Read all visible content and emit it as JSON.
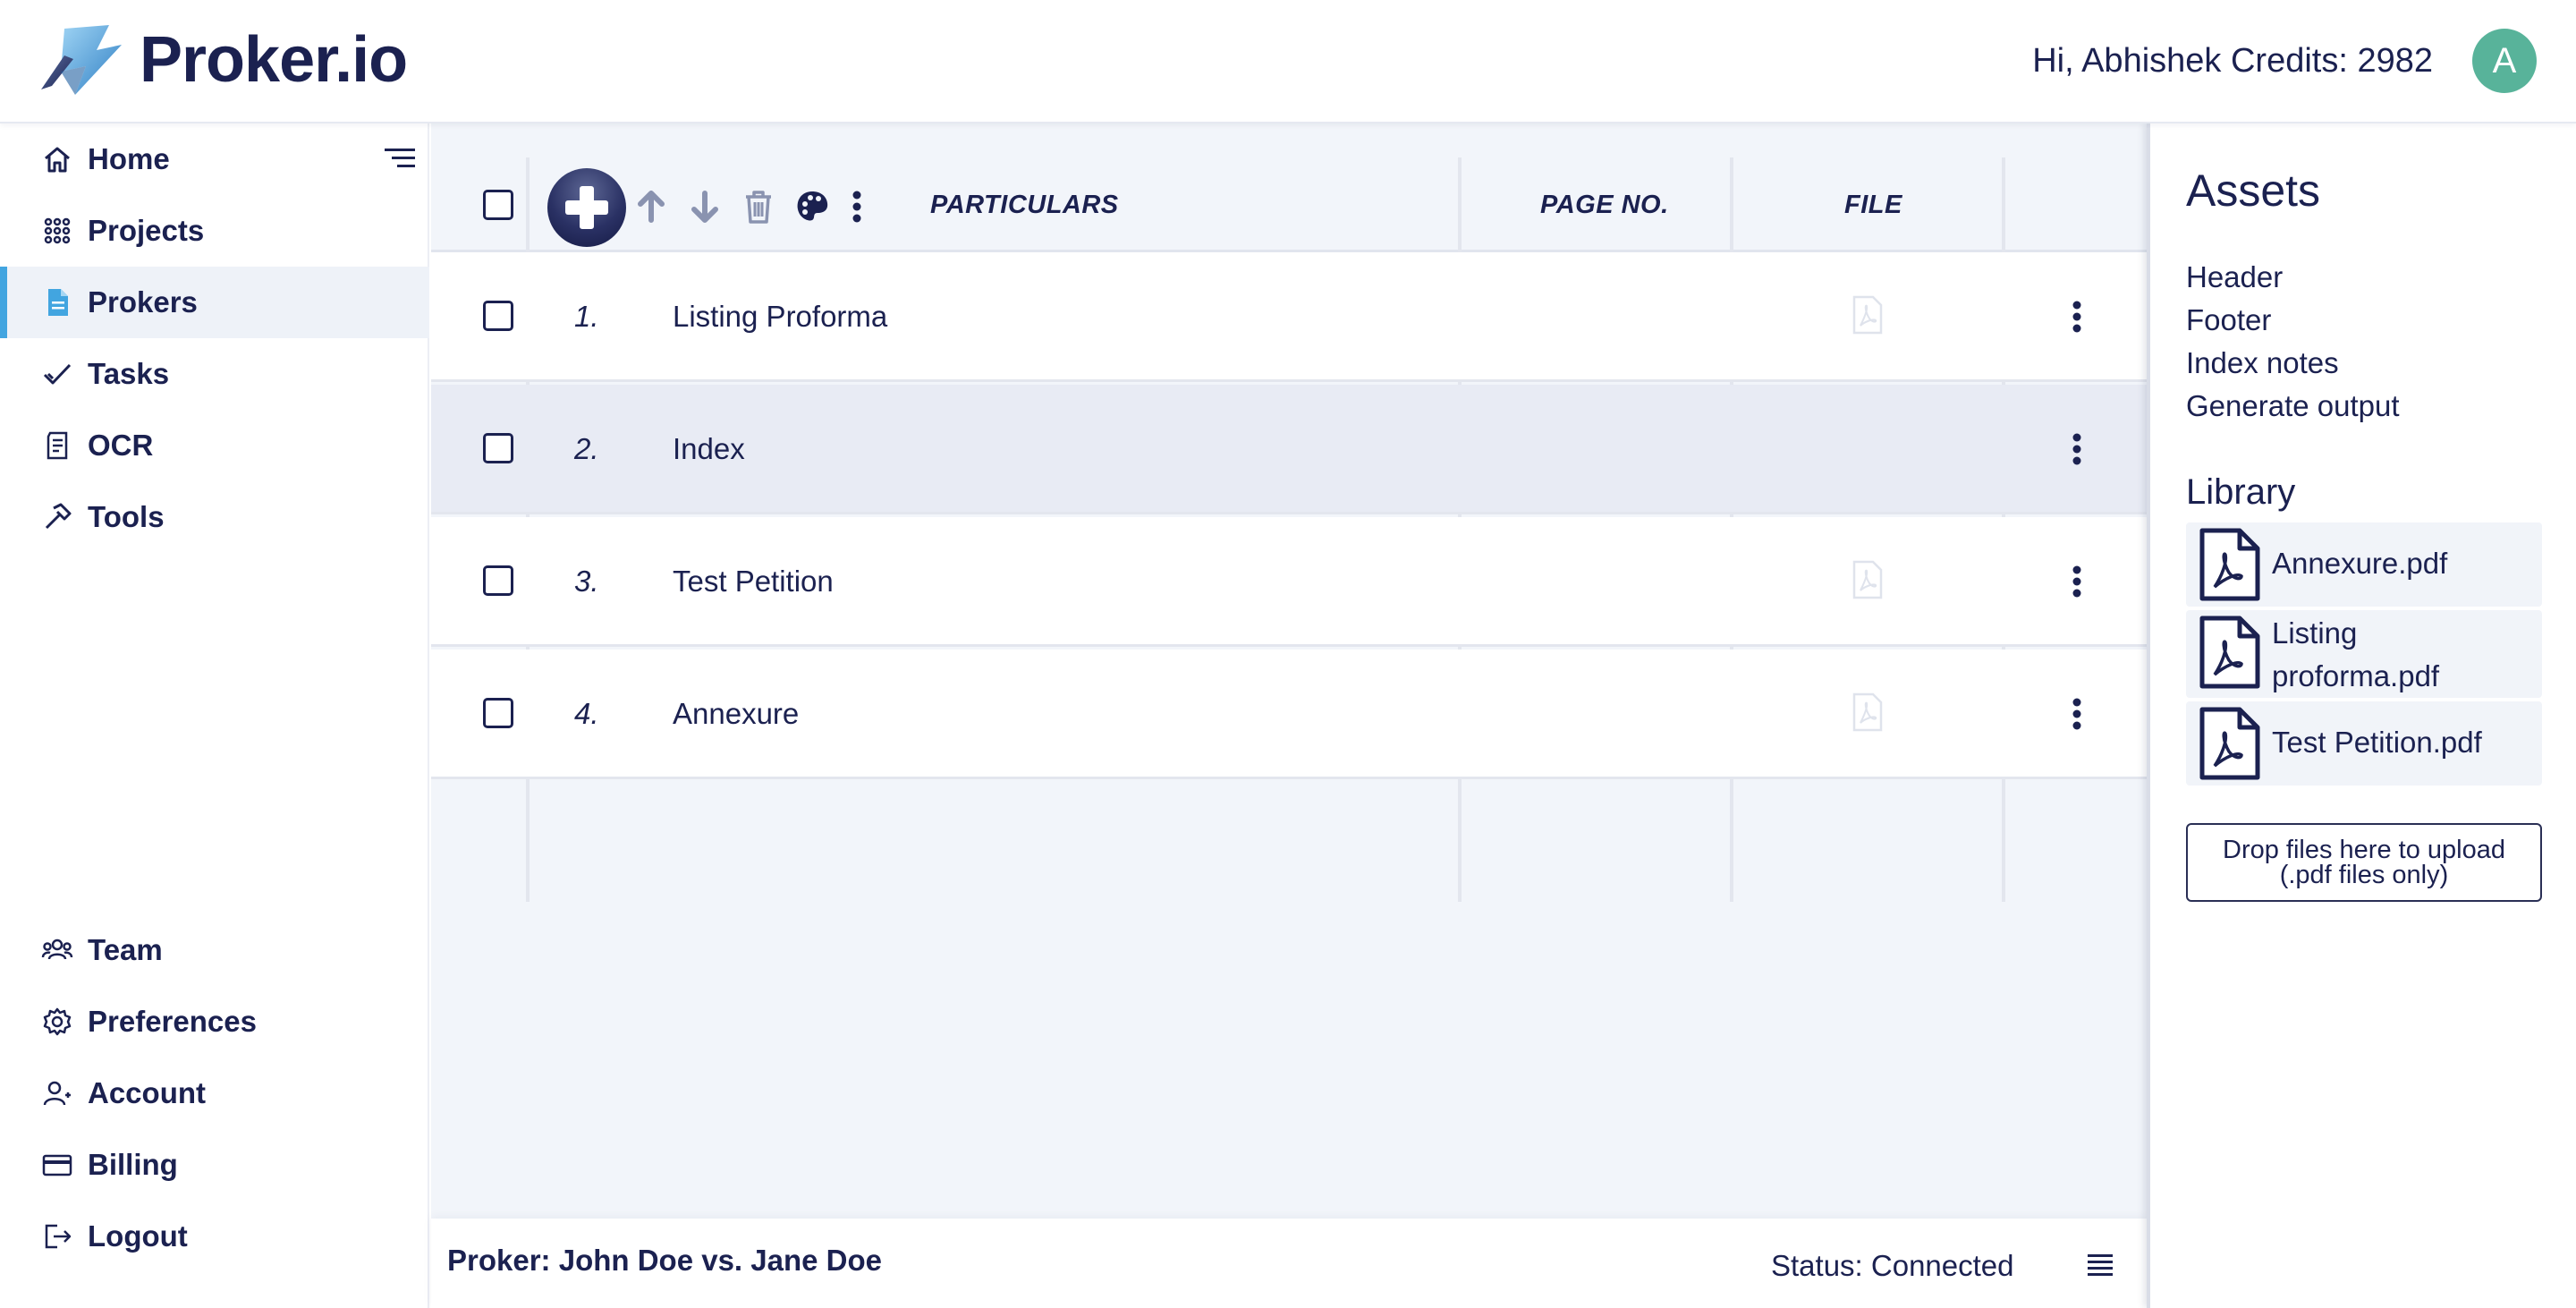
{
  "header": {
    "brand": "Proker.io",
    "greeting": "Hi, Abhishek Credits: 2982",
    "avatar_initial": "A",
    "avatar_color": "#58b39a"
  },
  "sidebar": {
    "top_items": [
      {
        "label": "Home",
        "icon": "home-icon"
      },
      {
        "label": "Projects",
        "icon": "grid-icon"
      },
      {
        "label": "Prokers",
        "icon": "document-icon",
        "active": true
      },
      {
        "label": "Tasks",
        "icon": "check-icon"
      },
      {
        "label": "OCR",
        "icon": "scan-document-icon"
      },
      {
        "label": "Tools",
        "icon": "hammer-icon"
      }
    ],
    "bottom_items": [
      {
        "label": "Team",
        "icon": "team-icon"
      },
      {
        "label": "Preferences",
        "icon": "gear-icon"
      },
      {
        "label": "Account",
        "icon": "user-icon"
      },
      {
        "label": "Billing",
        "icon": "card-icon"
      },
      {
        "label": "Logout",
        "icon": "logout-icon"
      }
    ],
    "active_color": "#42a5e0"
  },
  "table": {
    "columns": {
      "particulars": "PARTICULARS",
      "page_no": "PAGE NO.",
      "file": "FILE"
    },
    "rows": [
      {
        "num": "1.",
        "title": "Listing Proforma",
        "page_no": "",
        "has_file_icon": true
      },
      {
        "num": "2.",
        "title": "Index",
        "page_no": "",
        "has_file_icon": false,
        "selected": true
      },
      {
        "num": "3.",
        "title": "Test Petition",
        "page_no": "",
        "has_file_icon": true
      },
      {
        "num": "4.",
        "title": "Annexure",
        "page_no": "",
        "has_file_icon": true
      }
    ]
  },
  "footer": {
    "proker_name": "Proker: John Doe vs. Jane Doe",
    "status": "Status: Connected"
  },
  "assets": {
    "title": "Assets",
    "links": [
      "Header",
      "Footer",
      "Index notes",
      "Generate output"
    ],
    "library_title": "Library",
    "library": [
      "Annexure.pdf",
      "Listing proforma.pdf",
      "Test Petition.pdf"
    ],
    "dropzone_line1": "Drop files here to upload",
    "dropzone_line2": "(.pdf files only)"
  },
  "colors": {
    "navy": "#1b2150",
    "main_bg": "#f2f5fa",
    "selected_row": "#e8ebf4"
  }
}
